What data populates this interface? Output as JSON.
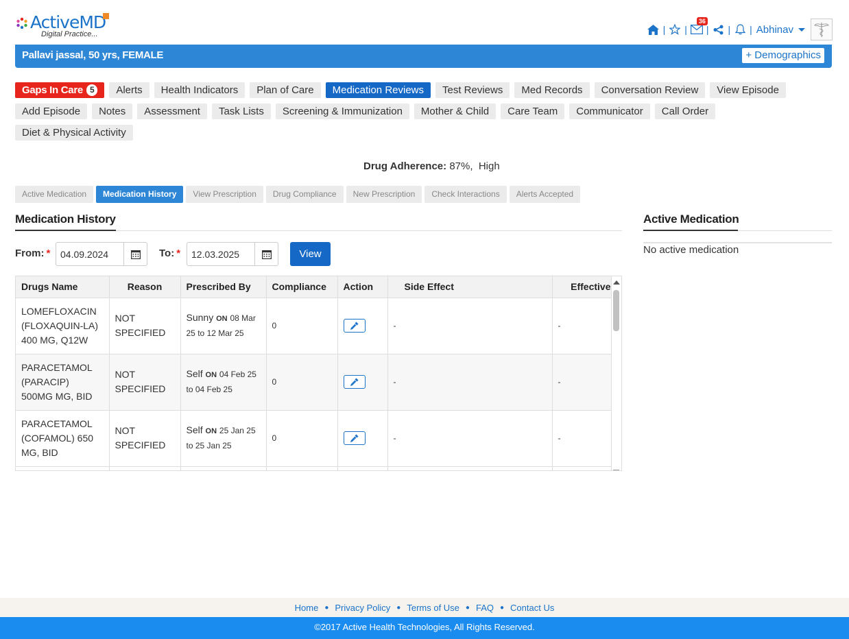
{
  "header": {
    "logo_text": "ActiveMD",
    "logo_tagline": "Digital Practice...",
    "notifications_count": "36",
    "user_name": "Abhinav"
  },
  "patient": {
    "summary": "Pallavi jassal, 50 yrs, FEMALE",
    "demographics_label": "+ Demographics"
  },
  "nav": {
    "gaps_label": "Gaps In Care",
    "gaps_count": "5",
    "row1": [
      "Alerts",
      "Health Indicators",
      "Plan of Care",
      "Medication Reviews",
      "Test Reviews",
      "Med Records",
      "Conversation Review",
      "View Episode"
    ],
    "row2": [
      "Add Episode",
      "Notes",
      "Assessment",
      "Task Lists",
      "Screening & Immunization",
      "Mother & Child",
      "Care Team",
      "Communicator",
      "Call Order"
    ],
    "row3": [
      "Diet & Physical Activity"
    ],
    "active": "Medication Reviews"
  },
  "adherence": {
    "label": "Drug Adherence:",
    "value": "87%,  High"
  },
  "subtabs": [
    "Active Medication",
    "Medication History",
    "View Prescription",
    "Drug Compliance",
    "New Prescription",
    "Check Interactions",
    "Alerts Accepted"
  ],
  "history": {
    "title": "Medication History",
    "from_label": "From:",
    "from_value": "04.09.2024",
    "to_label": "To:",
    "to_value": "12.03.2025",
    "view_label": "View",
    "columns": [
      "Drugs Name",
      "Reason",
      "Prescribed By",
      "Compliance",
      "Action",
      "Side Effect",
      "Effective"
    ],
    "rows": [
      {
        "drug": [
          "LOMEFLOXACIN",
          "(FLOXAQUIN-LA)",
          "400 MG, Q12W"
        ],
        "reason": [
          "NOT",
          "SPECIFIED"
        ],
        "by": "Sunny",
        "on": "ON",
        "from_date": "08 Mar",
        "to_word": "to",
        "period": "25",
        "to_date": "12 Mar 25",
        "compliance": "0",
        "side_effect": "-",
        "effective": "-"
      },
      {
        "drug": [
          "PARACETAMOL",
          "(PARACIP)",
          "500MG MG, BID"
        ],
        "reason": [
          "NOT",
          "SPECIFIED"
        ],
        "by": "Self",
        "on": "ON",
        "from_date": "04 Feb 25",
        "to_word": "to",
        "period": "",
        "to_date": "04 Feb 25",
        "compliance": "0",
        "side_effect": "-",
        "effective": "-"
      },
      {
        "drug": [
          "PARACETAMOL",
          "(COFAMOL) 650",
          "MG, BID"
        ],
        "reason": [
          "NOT",
          "SPECIFIED"
        ],
        "by": "Self",
        "on": "ON",
        "from_date": "25 Jan 25",
        "to_word": "to",
        "period": "",
        "to_date": "25 Jan 25",
        "compliance": "0",
        "side_effect": "-",
        "effective": "-"
      }
    ]
  },
  "active_medication": {
    "title": "Active Medication",
    "empty_text": "No active medication"
  },
  "footer": {
    "links": [
      "Home",
      "Privacy Policy",
      "Terms of Use",
      "FAQ",
      "Contact Us"
    ],
    "copyright": "©2017 Active Health Technologies, All Rights Reserved."
  }
}
